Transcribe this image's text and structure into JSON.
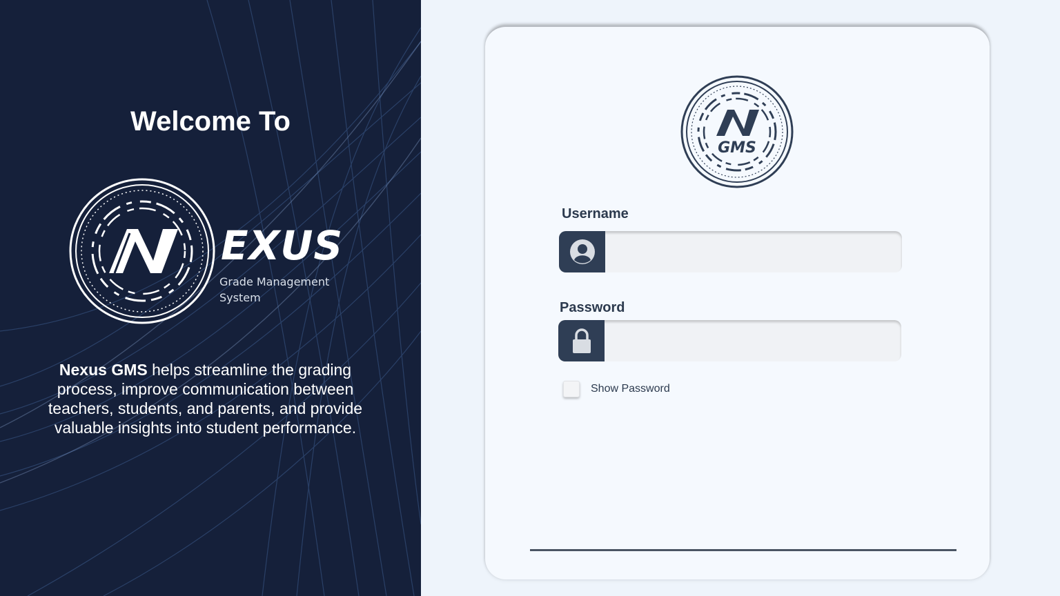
{
  "left_panel": {
    "welcome": "Welcome To",
    "brand_word": "EXUS",
    "brand_subtitle": "Grade Management System",
    "description_bold": "Nexus GMS",
    "description_rest": " helps streamline the grading process, improve  communication between teachers, students, and parents, and provide valuable insights  into student performance.",
    "logo_icon": "nexus-n-logo",
    "background_color": "#15203a"
  },
  "login": {
    "logo_text": "GMS",
    "logo_icon": "gms-n-logo",
    "username_label": "Username",
    "username_value": "",
    "username_icon": "user-avatar-icon",
    "password_label": "Password",
    "password_value": "",
    "password_icon": "lock-icon",
    "show_password_label": "Show Password",
    "show_password_checked": false,
    "accent_color": "#2f3e55"
  }
}
